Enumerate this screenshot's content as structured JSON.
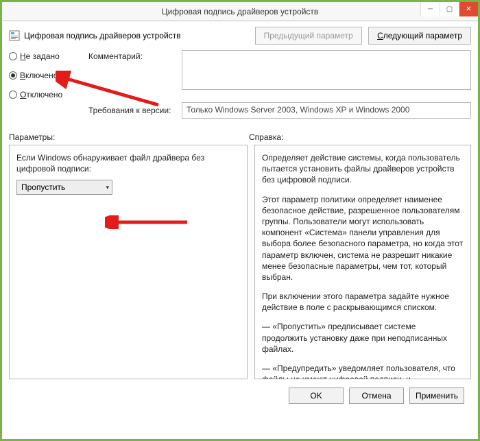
{
  "window": {
    "title": "Цифровая подпись драйверов устройств"
  },
  "header": {
    "subtitle": "Цифровая подпись драйверов устройств",
    "prev_btn": "Предыдущий параметр",
    "next_btn_u": "С",
    "next_btn_rest": "ледующий параметр"
  },
  "radios": {
    "not_set_u": "Н",
    "not_set_rest": "е задано",
    "enabled_u": "В",
    "enabled_rest": "ключено",
    "disabled_u": "О",
    "disabled_rest": "тключено"
  },
  "labels": {
    "comment": "Комментарий:",
    "requirements": "Требования к версии:",
    "params": "Параметры:",
    "help": "Справка:"
  },
  "requirements_value": "Только Windows Server 2003, Windows XP и Windows 2000",
  "params_panel": {
    "label": "Если Windows обнаруживает файл драйвера без цифровой подписи:",
    "dropdown_value": "Пропустить"
  },
  "help_panel": {
    "p1": "Определяет действие системы, когда пользователь пытается установить файлы драйверов устройств без цифровой подписи.",
    "p2": "Этот параметр политики определяет наименее безопасное действие, разрешенное пользователям группы. Пользователи могут использовать компонент «Система» панели управления для выбора более безопасного параметра, но когда этот параметр включен, система не разрешит никакие менее безопасные параметры, чем тот, который выбран.",
    "p3": "При включении этого параметра задайте нужное действие в поле с раскрывающимся списком.",
    "p4": "— «Пропустить» предписывает системе продолжить установку даже при неподписанных файлах.",
    "p5": "— «Предупредить» уведомляет пользователя, что файлы не имеют цифровой подписи, и предоставляет пользователю"
  },
  "footer": {
    "ok": "OK",
    "cancel": "Отмена",
    "apply": "Применить"
  }
}
